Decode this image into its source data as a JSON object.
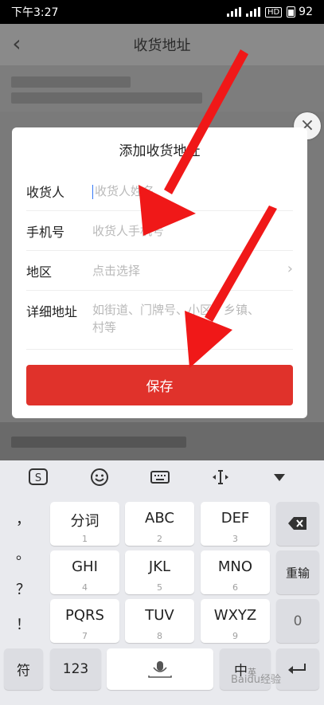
{
  "status_bar": {
    "time": "下午3:27",
    "battery": "92",
    "network": "HD"
  },
  "header": {
    "title": "收货地址"
  },
  "dialog": {
    "title": "添加收货地址",
    "fields": [
      {
        "label": "收货人",
        "placeholder": "收货人姓名"
      },
      {
        "label": "手机号",
        "placeholder": "收货人手机号"
      },
      {
        "label": "地区",
        "placeholder": "点击选择"
      },
      {
        "label": "详细地址",
        "placeholder": "如街道、门牌号、小区、乡镇、村等"
      }
    ],
    "save_label": "保存"
  },
  "keyboard": {
    "punctuation": [
      "，",
      "。",
      "？",
      "！"
    ],
    "keys": [
      {
        "main": "分词",
        "sub": "1"
      },
      {
        "main": "ABC",
        "sub": "2"
      },
      {
        "main": "DEF",
        "sub": "3"
      },
      {
        "main": "GHI",
        "sub": "4"
      },
      {
        "main": "JKL",
        "sub": "5"
      },
      {
        "main": "MNO",
        "sub": "6"
      },
      {
        "main": "PQRS",
        "sub": "7"
      },
      {
        "main": "TUV",
        "sub": "8"
      },
      {
        "main": "WXYZ",
        "sub": "9"
      }
    ],
    "reenter_label": "重输",
    "zero_label": "0",
    "symbol_label": "符",
    "num_label": "123",
    "lang_label": "中",
    "lang_sub": "英"
  },
  "watermark": "Baidu经验",
  "colors": {
    "accent_red": "#e0322b",
    "cursor_blue": "#3478f6"
  }
}
